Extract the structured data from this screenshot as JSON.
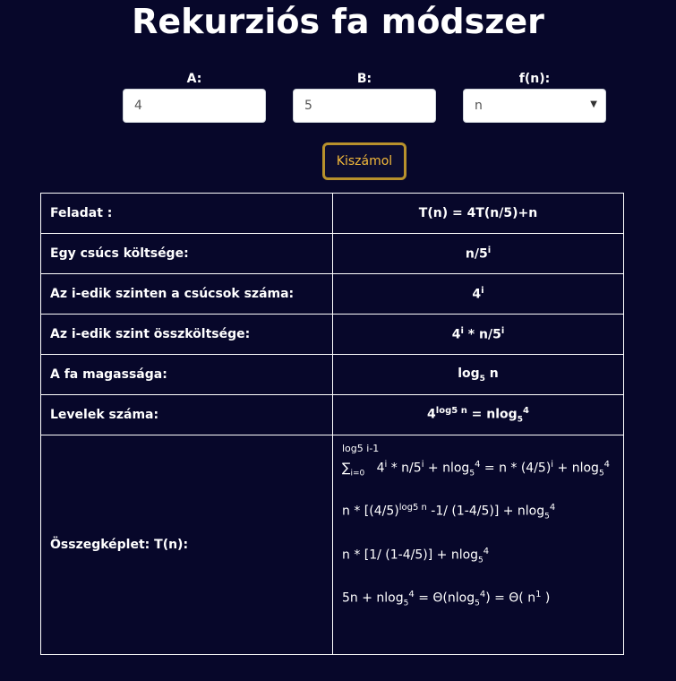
{
  "title": "Rekurziós fa módszer",
  "inputs": {
    "a_label": "A:",
    "a_value": "4",
    "b_label": "B:",
    "b_value": "5",
    "f_label": "f(n):",
    "f_value": "n"
  },
  "button": {
    "label": "Kiszámol"
  },
  "table": {
    "row1": {
      "label": "Feladat :",
      "value": "T(n) = 4T(n/5)+n"
    },
    "row2": {
      "label": "Egy csúcs költsége:",
      "value_base": "n/5",
      "value_sup": "i"
    },
    "row3": {
      "label": "Az i-edik szinten a csúcsok száma:",
      "value_base": "4",
      "value_sup": "i"
    },
    "row4": {
      "label": "Az i-edik szint összköltsége:",
      "p1": "4",
      "s1": "i",
      "p2": " * n/5",
      "s2": "i"
    },
    "row5": {
      "label": "A fa magassága:",
      "p1": "log",
      "sub1": "5",
      "p2": " n"
    },
    "row6": {
      "label": "Levelek száma:",
      "p1": "4",
      "sup1": "log5 n",
      "p2": " = nlog",
      "sub2": "5",
      "sup2": "4"
    },
    "row7": {
      "label": "Összegképlet: T(n):",
      "limit": "log5 i-1",
      "line1": {
        "sigma": "∑",
        "sigma_sub": "i=0",
        "a": "4",
        "a_sup": "i",
        "b": " * n/5",
        "b_sup": "i",
        "c": " + nlog",
        "c_sub": "5",
        "c_sup": "4",
        "d": " = n * (4/5)",
        "d_sup": "i",
        "e": " + nlog",
        "e_sub": "5",
        "e_sup": "4"
      },
      "line2": {
        "a": "n * [(4/5)",
        "a_sup": "log5 n",
        "b": " -1/ (1-4/5)] + nlog",
        "b_sub": "5",
        "b_sup": "4"
      },
      "line3": {
        "a": "n * [1/ (1-4/5)] + nlog",
        "a_sub": "5",
        "a_sup": "4"
      },
      "line4": {
        "a": "5n + nlog",
        "a_sub": "5",
        "a_sup": "4",
        "b": " = Θ(nlog",
        "b_sub": "5",
        "b_sup": "4",
        "c": ") = Θ( n",
        "c_sup": "1",
        "d": " )"
      }
    }
  }
}
